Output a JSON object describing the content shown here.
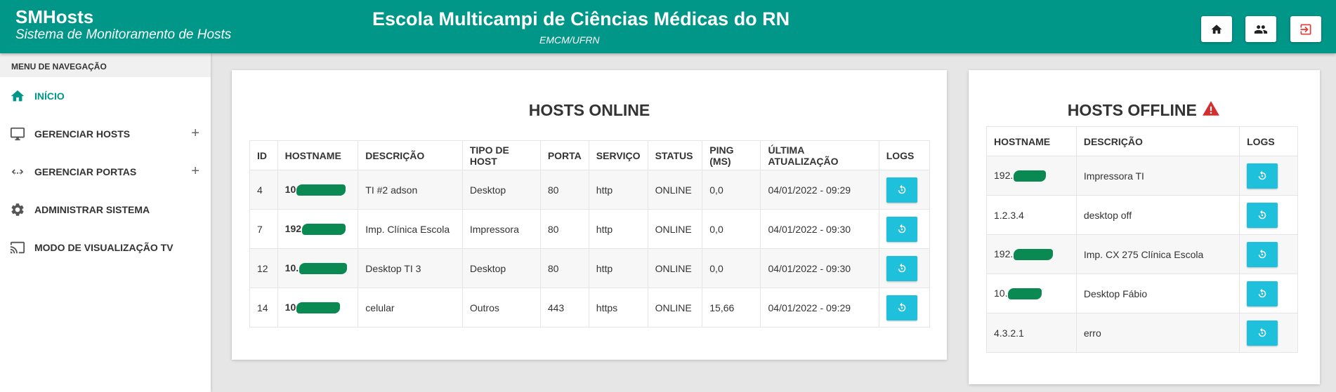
{
  "header": {
    "brand_title": "SMHosts",
    "brand_subtitle": "Sistema de Monitoramento de Hosts",
    "center_title": "Escola Multicampi de Ciências Médicas do RN",
    "center_subtitle": "EMCM/UFRN",
    "buttons": [
      {
        "icon": "home-icon"
      },
      {
        "icon": "users-icon"
      },
      {
        "icon": "logout-icon",
        "color": "#e53935"
      }
    ]
  },
  "sidebar": {
    "heading": "MENU DE NAVEGAÇÃO",
    "items": [
      {
        "label": "INÍCIO",
        "icon": "home-icon",
        "active": true
      },
      {
        "label": "GERENCIAR HOSTS",
        "icon": "monitor-icon",
        "expand": "+"
      },
      {
        "label": "GERENCIAR PORTAS",
        "icon": "ports-icon",
        "expand": "+"
      },
      {
        "label": "ADMINISTRAR SISTEMA",
        "icon": "gear-icon"
      },
      {
        "label": "MODO DE VISUALIZAÇÃO TV",
        "icon": "cast-icon"
      }
    ]
  },
  "online": {
    "title": "HOSTS ONLINE",
    "columns": [
      "ID",
      "HOSTNAME",
      "DESCRIÇÃO",
      "TIPO DE HOST",
      "PORTA",
      "SERVIÇO",
      "STATUS",
      "PING (MS)",
      "ÚLTIMA ATUALIZAÇÃO",
      "LOGS"
    ],
    "rows": [
      {
        "id": "4",
        "hostname": "10",
        "descricao": "TI #2 adson",
        "tipo": "Desktop",
        "porta": "80",
        "servico": "http",
        "status": "ONLINE",
        "ping": "0,0",
        "atualizacao": "04/01/2022 - 09:29"
      },
      {
        "id": "7",
        "hostname": "192",
        "descricao": "Imp. Clínica Escola",
        "tipo": "Impressora",
        "porta": "80",
        "servico": "http",
        "status": "ONLINE",
        "ping": "0,0",
        "atualizacao": "04/01/2022 - 09:30"
      },
      {
        "id": "12",
        "hostname": "10.",
        "descricao": "Desktop TI 3",
        "tipo": "Desktop",
        "porta": "80",
        "servico": "http",
        "status": "ONLINE",
        "ping": "0,0",
        "atualizacao": "04/01/2022 - 09:30"
      },
      {
        "id": "14",
        "hostname": "10",
        "descricao": "celular",
        "tipo": "Outros",
        "porta": "443",
        "servico": "https",
        "status": "ONLINE",
        "ping": "15,66",
        "atualizacao": "04/01/2022 - 09:29"
      }
    ]
  },
  "offline": {
    "title": "HOSTS OFFLINE",
    "warning_icon": "warning-icon",
    "warning_color": "#d32f2f",
    "columns": [
      "HOSTNAME",
      "DESCRIÇÃO",
      "LOGS"
    ],
    "rows": [
      {
        "hostname": "192.",
        "descricao": "Impressora TI"
      },
      {
        "hostname": "1.2.3.4",
        "descricao": "desktop off"
      },
      {
        "hostname": "192.",
        "descricao": "Imp. CX 275 Clínica Escola"
      },
      {
        "hostname": "10.",
        "descricao": "Desktop Fábio"
      },
      {
        "hostname": "4.3.2.1",
        "descricao": "erro"
      }
    ]
  },
  "colors": {
    "primary": "#009688",
    "log_button": "#1ec0dc",
    "redaction": "#0a8a52"
  }
}
